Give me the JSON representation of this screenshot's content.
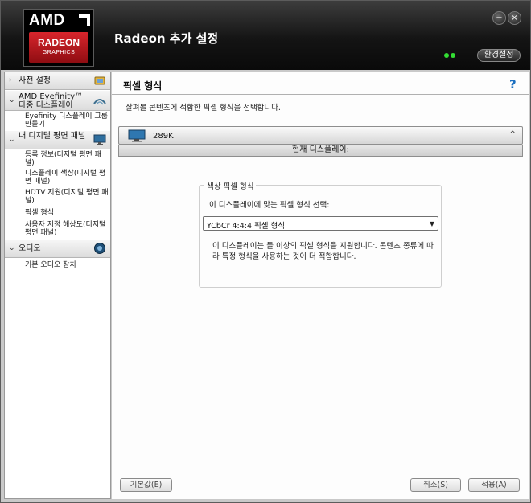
{
  "header": {
    "app_title": "Radeon 추가 설정",
    "logo": {
      "brand": "AMD",
      "product": "RADEON",
      "sub": "GRAPHICS"
    },
    "preferences_label": "환경설정",
    "minimize_glyph": "−",
    "close_glyph": "×",
    "status_icon": "green-dots-icon"
  },
  "sidebar": {
    "sections": [
      {
        "label": "사전 설정",
        "chevron": "›",
        "icon": "presets-icon"
      },
      {
        "label": "AMD Eyefinity™ 다중 디스플레이",
        "chevron": "⌄",
        "icon": "eyefinity-icon"
      },
      {
        "label": "내 디지털 평면 패널",
        "chevron": "⌄",
        "icon": "monitor-icon"
      },
      {
        "label": "오디오",
        "chevron": "⌄",
        "icon": "speaker-icon"
      }
    ],
    "items": [
      "Eyefinity 디스플레이 그룹 만들기",
      "등록 정보(디지털 평면 패널)",
      "디스플레이 색상(디지털 평면 패널)",
      "HDTV 지원(디지털 평면 패널)",
      "픽셀 형식",
      "사용자 지정 해상도(디지털 평면 패널)",
      "기본 오디오 장치"
    ]
  },
  "main": {
    "page_title": "픽셀 형식",
    "help_glyph": "?",
    "description": "살펴볼 콘텐츠에 적합한 픽셀 형식을 선택합니다.",
    "display": {
      "name": "289K",
      "collapse_glyph": "^",
      "current_label": "현재 디스플레이:"
    },
    "color_pixel_format": {
      "group_title": "색상 픽셀 형식",
      "select_label": "이 디스플레이에 맞는 픽셀 형식 선택:",
      "selected_value": "YCbCr 4:4:4 픽셀 형식",
      "note": "이 디스플레이는 둘 이상의 픽셀 형식을 지원합니다. 콘텐츠 종류에 따라 특정 형식을 사용하는 것이 더 적합합니다."
    },
    "buttons": {
      "defaults": "기본값(E)",
      "cancel": "취소(S)",
      "apply": "적용(A)"
    }
  },
  "colors": {
    "header_dark": "#141414",
    "amd_red": "#d8252c",
    "help_blue": "#1b6fc0",
    "status_green": "#33dd33"
  }
}
